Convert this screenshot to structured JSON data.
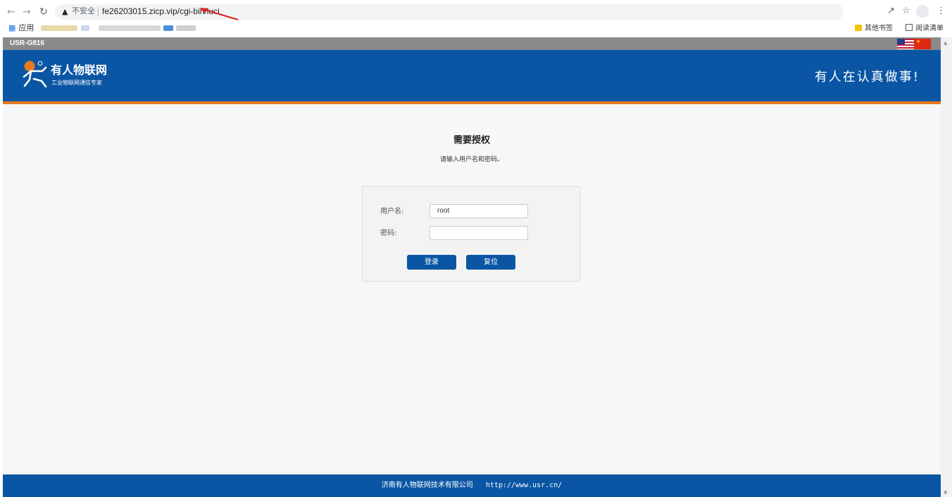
{
  "browser": {
    "insecure_label": "不安全",
    "url": "fe26203015.zicp.vip/cgi-bin/luci",
    "bookmarks": {
      "apps_label": "应用",
      "other_bookmarks": "其他书签",
      "reading_list": "阅读清单"
    }
  },
  "page": {
    "model": "USR-G816",
    "brand": "有人物联网",
    "brand_sub": "工业物联网通信专家",
    "slogan": "有人在认真做事!",
    "title": "需要授权",
    "description": "请输入用户名和密码。",
    "form": {
      "username_label": "用户名:",
      "username_value": "root",
      "password_label": "密码:",
      "password_value": "",
      "login_button": "登录",
      "reset_button": "复位"
    },
    "footer": {
      "company": "济南有人物联网技术有限公司",
      "website": "http://www.usr.cn/"
    }
  },
  "colors": {
    "header_blue": "#0a56a4",
    "accent_orange": "#e87a1e",
    "annotation_red": "#d9251c"
  },
  "icons": [
    "back-icon",
    "forward-icon",
    "reload-icon",
    "warning-icon",
    "share-icon",
    "star-icon",
    "profile-icon",
    "menu-icon",
    "apps-grid-icon",
    "folder-icon",
    "reading-list-icon",
    "us-flag-icon",
    "cn-flag-icon",
    "logo-icon"
  ]
}
